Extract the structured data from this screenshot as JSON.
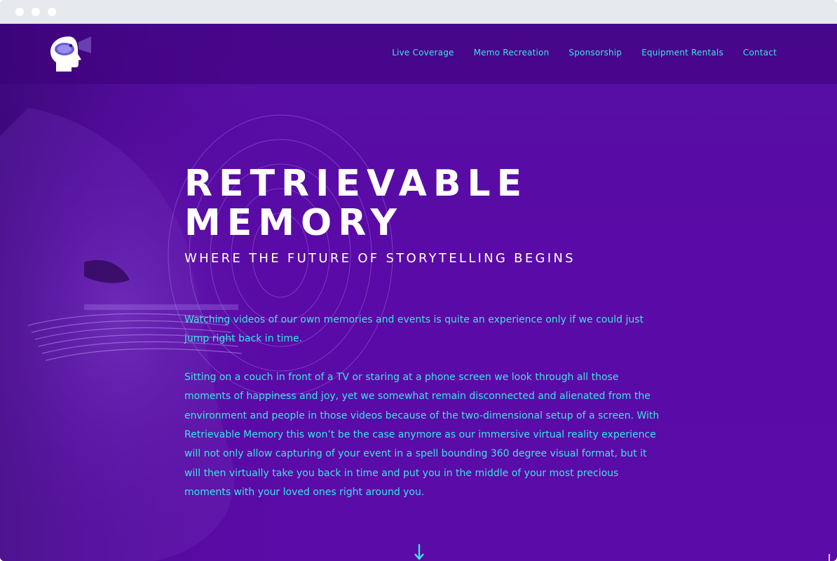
{
  "window": {
    "controls": [
      "close",
      "minimize",
      "maximize"
    ]
  },
  "header": {
    "logo_icon": "head-vr-logo-icon",
    "nav": [
      {
        "label": "Live Coverage"
      },
      {
        "label": "Memo Recreation"
      },
      {
        "label": "Sponsorship"
      },
      {
        "label": "Equipment Rentals"
      },
      {
        "label": "Contact"
      }
    ]
  },
  "hero": {
    "title_line1": "RETRIEVABLE",
    "title_line2": "MEMORY",
    "subtitle": "WHERE THE FUTURE OF STORYTELLING BEGINS",
    "paragraph1": "Watching videos of our own memories and events is quite an experience only if we could just jump right back in time.",
    "paragraph2": "Sitting on a couch in front of a TV or staring at a phone screen we look through all those moments of happiness and joy, yet we somewhat remain disconnected and alienated from the environment and people in those videos because of the two-dimensional setup of a screen. With Retrievable Memory this won’t be the case anymore as our immersive virtual reality experience will not only allow capturing of your event in a spell bounding 360 degree visual format, but it will then virtually take you back in time and put you in the middle of your most precious moments with your loved ones right around you.",
    "scroll_icon": "arrow-down-icon"
  },
  "colors": {
    "background": "#5a0aa6",
    "accent": "#38e6e4",
    "heading": "#ffffff",
    "header_bar": "#3c0078"
  }
}
